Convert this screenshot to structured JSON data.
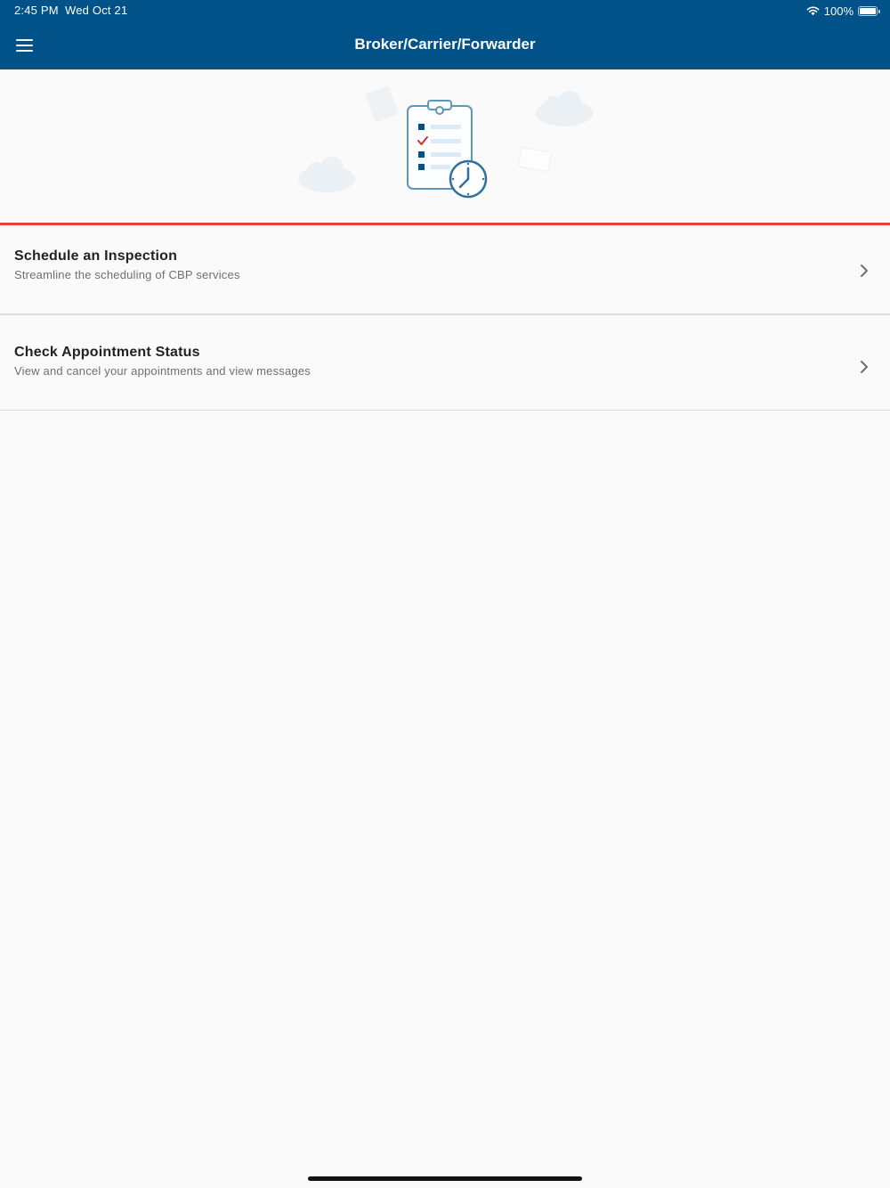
{
  "status_bar": {
    "time": "2:45 PM",
    "date": "Wed Oct 21",
    "battery_text": "100%",
    "battery_level": 1.0
  },
  "header": {
    "title": "Broker/Carrier/Forwarder",
    "menu_icon": "hamburger-menu-icon",
    "background_color": "#005288"
  },
  "hero": {
    "illustration": "clipboard-checklist-clock-illustration",
    "divider_color": "#e8403a"
  },
  "menu": {
    "items": [
      {
        "title": "Schedule an Inspection",
        "subtitle": "Streamline the scheduling of CBP services",
        "icon": "chevron-right-icon"
      },
      {
        "title": "Check Appointment Status",
        "subtitle": "View and cancel your appointments and view messages",
        "icon": "chevron-right-icon"
      }
    ]
  }
}
